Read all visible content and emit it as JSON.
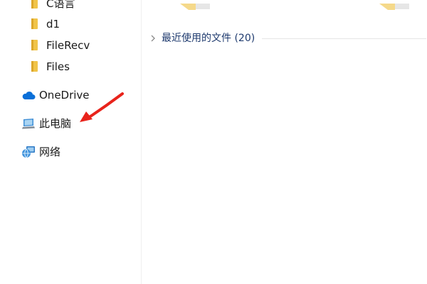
{
  "nav": {
    "folders": [
      {
        "label": "C语言",
        "icon": "folder-icon"
      },
      {
        "label": "d1",
        "icon": "folder-icon"
      },
      {
        "label": "FileRecv",
        "icon": "folder-icon"
      },
      {
        "label": "Files",
        "icon": "folder-icon"
      }
    ],
    "onedrive": {
      "label": "OneDrive",
      "icon": "cloud-icon"
    },
    "this_pc": {
      "label": "此电脑",
      "icon": "computer-icon"
    },
    "network": {
      "label": "网络",
      "icon": "network-icon"
    }
  },
  "content": {
    "recent_group": {
      "title": "最近使用的文件 (20)",
      "icon": "chevron-right-icon"
    }
  },
  "colors": {
    "folder": "#f0c449",
    "onedrive_blue": "#0a6fd8",
    "group_title": "#1e3a6e",
    "annotation_arrow": "#e8231b"
  }
}
